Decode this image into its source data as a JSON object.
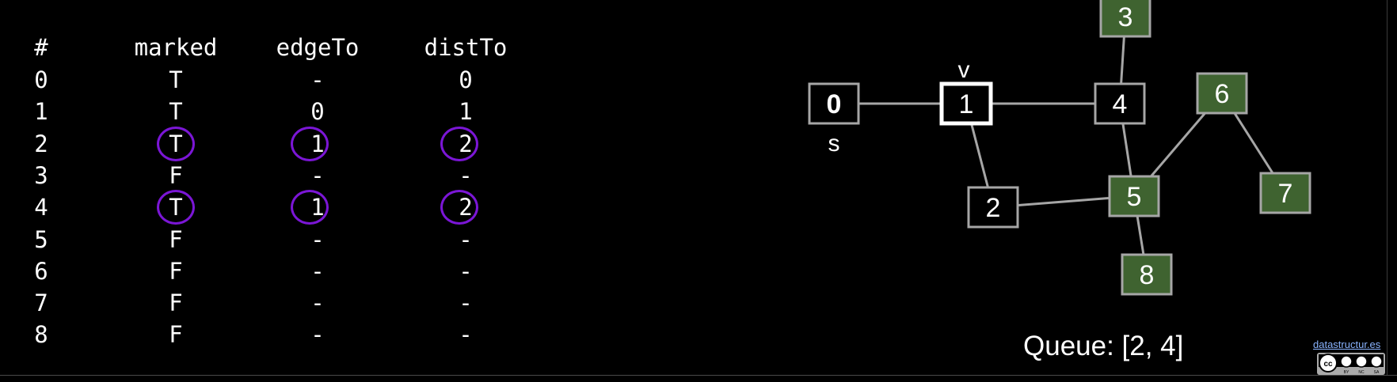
{
  "table": {
    "headers": [
      "#",
      "marked",
      "edgeTo",
      "distTo"
    ],
    "rows": [
      {
        "v": "0",
        "marked": "T",
        "edgeTo": "-",
        "distTo": "0"
      },
      {
        "v": "1",
        "marked": "T",
        "edgeTo": "0",
        "distTo": "1"
      },
      {
        "v": "2",
        "marked": "T",
        "edgeTo": "1",
        "distTo": "2",
        "highlight": true
      },
      {
        "v": "3",
        "marked": "F",
        "edgeTo": "-",
        "distTo": "-"
      },
      {
        "v": "4",
        "marked": "T",
        "edgeTo": "1",
        "distTo": "2",
        "highlight": true
      },
      {
        "v": "5",
        "marked": "F",
        "edgeTo": "-",
        "distTo": "-"
      },
      {
        "v": "6",
        "marked": "F",
        "edgeTo": "-",
        "distTo": "-"
      },
      {
        "v": "7",
        "marked": "F",
        "edgeTo": "-",
        "distTo": "-"
      },
      {
        "v": "8",
        "marked": "F",
        "edgeTo": "-",
        "distTo": "-"
      }
    ]
  },
  "graph": {
    "nodes": [
      {
        "id": "0",
        "label": "0",
        "state": "source"
      },
      {
        "id": "1",
        "label": "1",
        "state": "current"
      },
      {
        "id": "2",
        "label": "2",
        "state": "visited"
      },
      {
        "id": "3",
        "label": "3",
        "state": "unvisited"
      },
      {
        "id": "4",
        "label": "4",
        "state": "visited"
      },
      {
        "id": "5",
        "label": "5",
        "state": "unvisited"
      },
      {
        "id": "6",
        "label": "6",
        "state": "unvisited"
      },
      {
        "id": "7",
        "label": "7",
        "state": "unvisited"
      },
      {
        "id": "8",
        "label": "8",
        "state": "unvisited"
      }
    ],
    "edges": [
      [
        "0",
        "1"
      ],
      [
        "1",
        "4"
      ],
      [
        "1",
        "2"
      ],
      [
        "3",
        "4"
      ],
      [
        "4",
        "5"
      ],
      [
        "2",
        "5"
      ],
      [
        "5",
        "6"
      ],
      [
        "6",
        "7"
      ],
      [
        "5",
        "8"
      ]
    ],
    "source_label": "s",
    "current_label": "v"
  },
  "queue_text": "Queue: [2, 4]",
  "credit_text": "datastructur.es",
  "colors": {
    "background": "#000000",
    "unvisited_fill": "#3f6330",
    "node_border": "#a6a6a6",
    "current_border": "#ffffff",
    "edge": "#a6a6a6",
    "highlight_circle": "#7b16d6"
  },
  "license_icon": "cc-by-nc-sa-icon"
}
